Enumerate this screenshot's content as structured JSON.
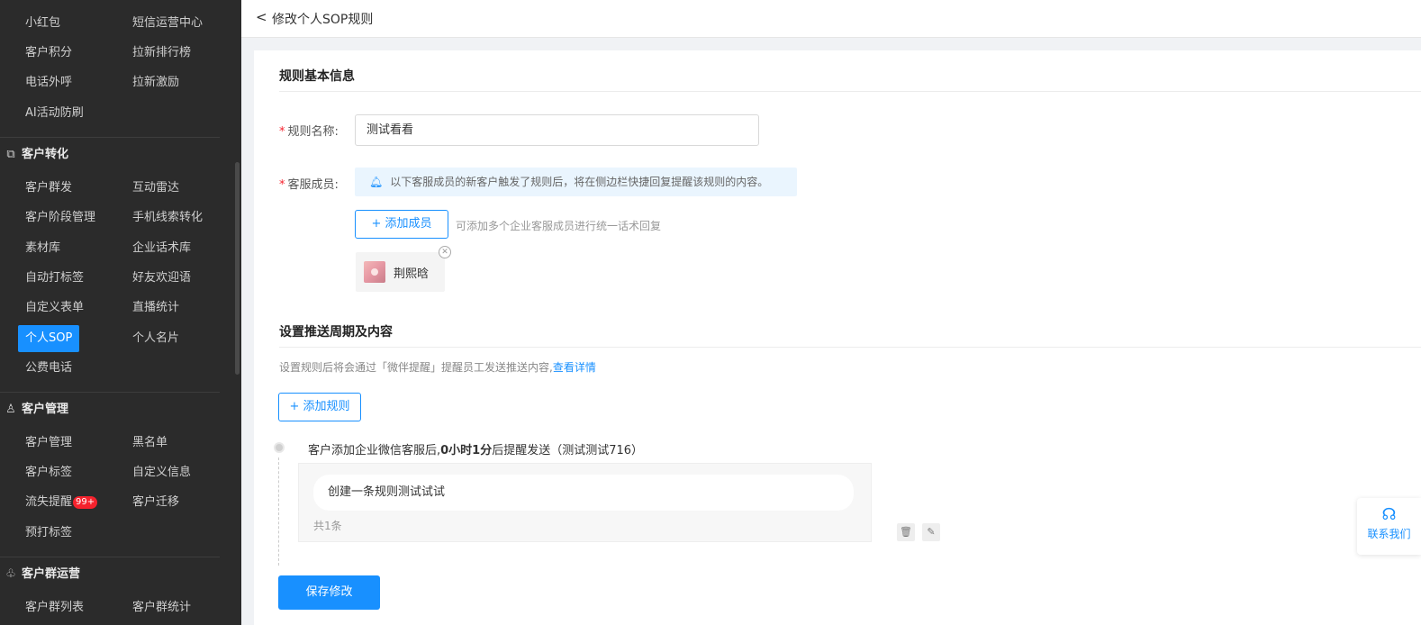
{
  "sidebar": {
    "rows": [
      {
        "c1": "小红包",
        "c2": "短信运营中心"
      },
      {
        "c1": "客户积分",
        "c2": "拉新排行榜"
      },
      {
        "c1": "电话外呼",
        "c2": "拉新激励"
      },
      {
        "c1": "AI活动防刷",
        "c2": ""
      }
    ],
    "section_conversion": "客户转化",
    "conversion_rows": [
      {
        "c1": "客户群发",
        "c2": "互动雷达"
      },
      {
        "c1": "客户阶段管理",
        "c2": "手机线索转化"
      },
      {
        "c1": "素材库",
        "c2": "企业话术库"
      },
      {
        "c1": "自动打标签",
        "c2": "好友欢迎语"
      },
      {
        "c1": "自定义表单",
        "c2": "直播统计"
      },
      {
        "c1": "个人SOP",
        "c2": "个人名片"
      },
      {
        "c1": "公费电话",
        "c2": ""
      }
    ],
    "section_management": "客户管理",
    "management_rows": [
      {
        "c1": "客户管理",
        "c2": "黑名单"
      },
      {
        "c1": "客户标签",
        "c2": "自定义信息"
      },
      {
        "c1": "流失提醒",
        "c2": "客户迁移"
      },
      {
        "c1": "预打标签",
        "c2": ""
      }
    ],
    "churn_badge": "99+",
    "section_group": "客户群运营",
    "group_rows": [
      {
        "c1": "客户群列表",
        "c2": "客户群统计"
      }
    ]
  },
  "header": {
    "back_glyph": "<",
    "title": "修改个人SOP规则"
  },
  "form": {
    "basic_title": "规则基本信息",
    "name_label": "规则名称:",
    "name_value": "测试看看",
    "members_label": "客服成员:",
    "notice": "以下客服成员的新客户触发了规则后，将在侧边栏快捷回复提醒该规则的内容。",
    "add_member_label": "+ 添加成员",
    "add_member_hint": "可添加多个企业客服成员进行统一话术回复",
    "member_name": "荆熙晗"
  },
  "push": {
    "title": "设置推送周期及内容",
    "desc": "设置规则后将会通过「微伴提醒」提醒员工发送推送内容,",
    "desc_link": "查看详情",
    "add_rule_label": "+ 添加规则",
    "rule_head_prefix": "客户添加企业微信客服后,",
    "rule_head_bold": "0小时1分",
    "rule_head_suffix": "后提醒发送（测试测试716）",
    "rule_message": "创建一条规则测试试试",
    "rule_count": "共1条",
    "save_label": "保存修改"
  },
  "contact": {
    "label": "联系我们"
  },
  "colors": {
    "accent": "#1890ff",
    "sidebar_bg": "#2b2b2b",
    "required": "#f5222d"
  }
}
